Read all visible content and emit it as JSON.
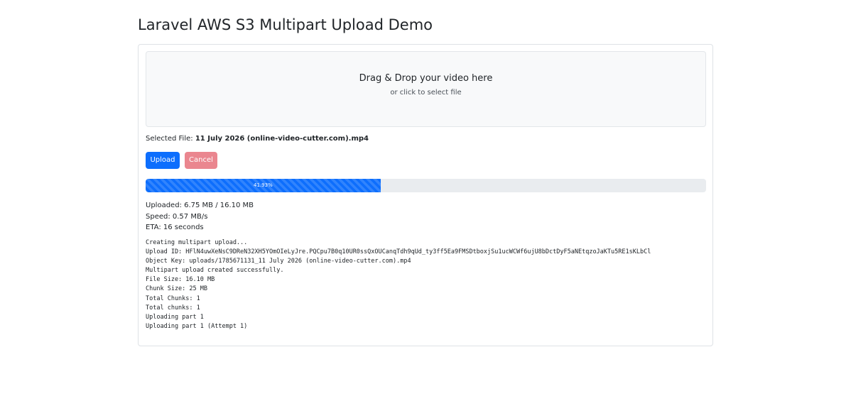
{
  "page": {
    "title": "Laravel AWS S3 Multipart Upload Demo"
  },
  "dropzone": {
    "title": "Drag & Drop your video here",
    "subtitle": "or click to select file"
  },
  "selected_file": {
    "label": "Selected File:",
    "name": "11 July 2026 (online-video-cutter.com).mp4"
  },
  "buttons": {
    "upload_label": "Upload",
    "cancel_label": "Cancel"
  },
  "progress": {
    "percent": 41.93,
    "label": "41.93%"
  },
  "stats": {
    "uploaded": "Uploaded: 6.75 MB / 16.10 MB",
    "speed": "Speed: 0.57 MB/s",
    "eta": "ETA: 16 seconds"
  },
  "log": [
    "Creating multipart upload...",
    "Upload ID: HFlN4uwXeNsC9DReN32XH5YOmOIeLyJre.PQCpu7B0q10UR0ssQxOUCanqTdh9qUd_ty3ff5Ea9FMSDtboxjSu1ucWCWf6ujU8bDctDyF5aNEtqzoJaKTu5RE1sKLbCl",
    "Object Key: uploads/1785671131_11 July 2026 (online-video-cutter.com).mp4",
    "Multipart upload created successfully.",
    "File Size: 16.10 MB",
    "Chunk Size: 25 MB",
    "Total Chunks: 1",
    "Total chunks: 1",
    "Uploading part 1",
    "Uploading part 1 (Attempt 1)"
  ],
  "colors": {
    "primary": "#0d6efd",
    "cancel": "#ea868f",
    "progress_track": "#e9ecef",
    "dropzone_bg": "#f8f9fa"
  }
}
